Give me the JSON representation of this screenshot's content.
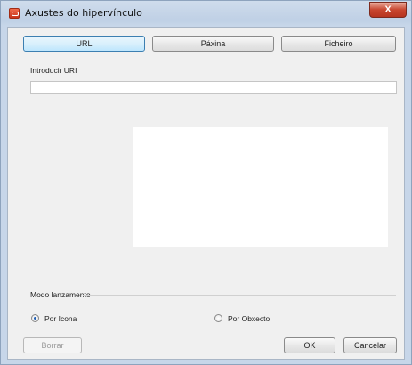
{
  "window": {
    "title": "Axustes do hipervínculo",
    "close_label": "X"
  },
  "tabs": [
    {
      "label": "URL",
      "active": true
    },
    {
      "label": "Páxina",
      "active": false
    },
    {
      "label": "Ficheiro",
      "active": false
    }
  ],
  "uri": {
    "label": "Introducir URI",
    "value": ""
  },
  "launch_mode": {
    "label": "Modo lanzamento",
    "options": [
      {
        "label": "Por Icona",
        "checked": true
      },
      {
        "label": "Por Obxecto",
        "checked": false
      }
    ]
  },
  "buttons": {
    "delete": "Borrar",
    "ok": "OK",
    "cancel": "Cancelar"
  }
}
